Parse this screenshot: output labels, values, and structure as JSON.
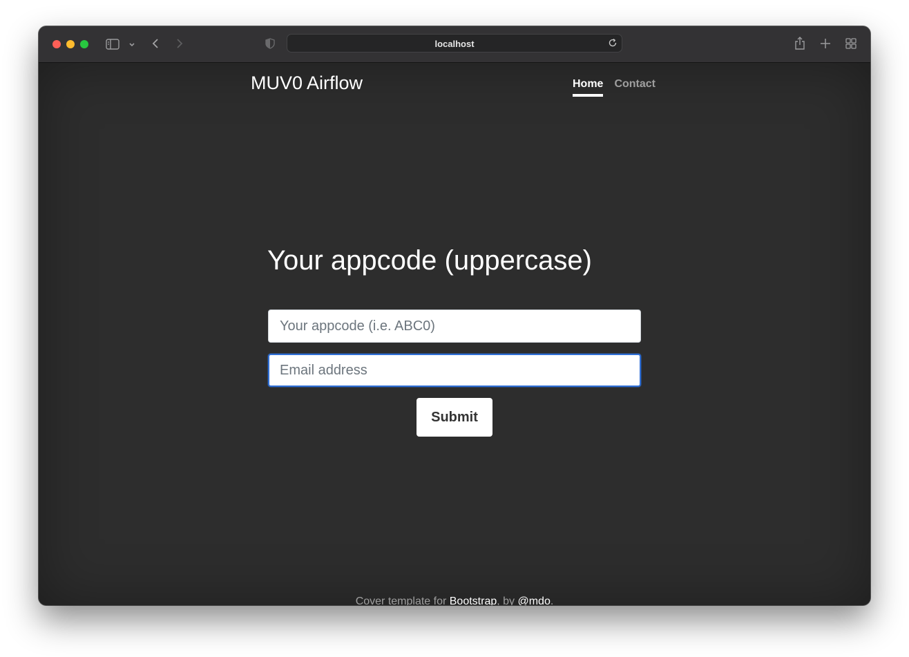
{
  "browser": {
    "url": "localhost",
    "icons": {
      "sidebar": "sidebar-icon",
      "dropdown": "chevron-down-icon",
      "back": "chevron-left-icon",
      "forward": "chevron-right-icon",
      "privacy": "shield-icon",
      "reload": "reload-icon",
      "share": "share-icon",
      "new_tab": "plus-icon",
      "tabs": "grid-icon"
    }
  },
  "header": {
    "brand": "MUV0 Airflow",
    "nav": [
      {
        "label": "Home",
        "active": true
      },
      {
        "label": "Contact",
        "active": false
      }
    ]
  },
  "form": {
    "heading": "Your appcode (uppercase)",
    "appcode_placeholder": "Your appcode (i.e. ABC0)",
    "email_placeholder": "Email address",
    "submit_label": "Submit"
  },
  "footer": {
    "prefix": "Cover template for ",
    "link1": "Bootstrap",
    "middle": ", by ",
    "link2": "@mdo",
    "suffix": "."
  },
  "colors": {
    "page_bg": "#2d2d2d",
    "focus_border": "#2f6fd6",
    "traffic_close": "#fe5f57",
    "traffic_min": "#febc2e",
    "traffic_max": "#28c840"
  }
}
